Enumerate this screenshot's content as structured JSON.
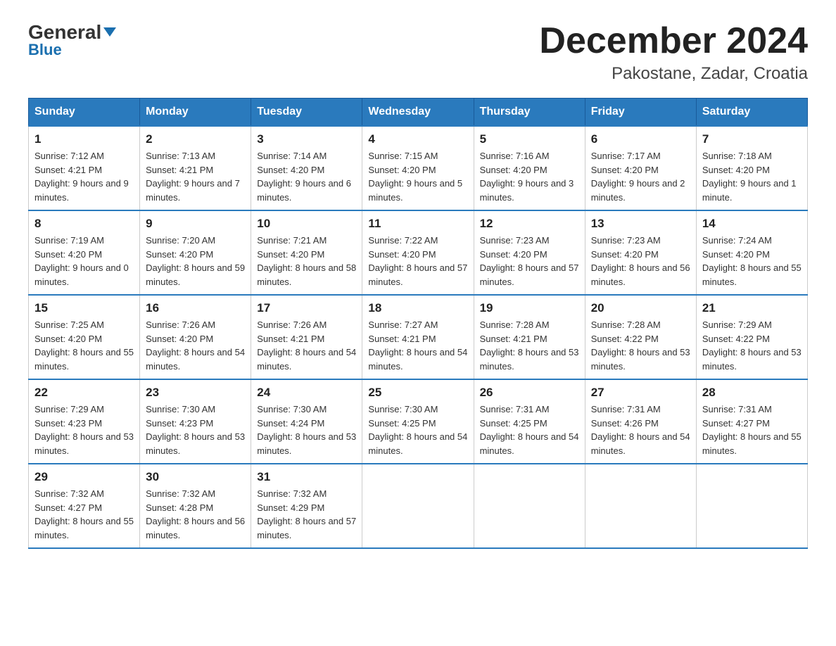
{
  "header": {
    "logo_general": "General",
    "logo_blue": "Blue",
    "month_title": "December 2024",
    "location": "Pakostane, Zadar, Croatia"
  },
  "weekdays": [
    "Sunday",
    "Monday",
    "Tuesday",
    "Wednesday",
    "Thursday",
    "Friday",
    "Saturday"
  ],
  "weeks": [
    [
      {
        "day": "1",
        "sunrise": "7:12 AM",
        "sunset": "4:21 PM",
        "daylight": "9 hours and 9 minutes."
      },
      {
        "day": "2",
        "sunrise": "7:13 AM",
        "sunset": "4:21 PM",
        "daylight": "9 hours and 7 minutes."
      },
      {
        "day": "3",
        "sunrise": "7:14 AM",
        "sunset": "4:20 PM",
        "daylight": "9 hours and 6 minutes."
      },
      {
        "day": "4",
        "sunrise": "7:15 AM",
        "sunset": "4:20 PM",
        "daylight": "9 hours and 5 minutes."
      },
      {
        "day": "5",
        "sunrise": "7:16 AM",
        "sunset": "4:20 PM",
        "daylight": "9 hours and 3 minutes."
      },
      {
        "day": "6",
        "sunrise": "7:17 AM",
        "sunset": "4:20 PM",
        "daylight": "9 hours and 2 minutes."
      },
      {
        "day": "7",
        "sunrise": "7:18 AM",
        "sunset": "4:20 PM",
        "daylight": "9 hours and 1 minute."
      }
    ],
    [
      {
        "day": "8",
        "sunrise": "7:19 AM",
        "sunset": "4:20 PM",
        "daylight": "9 hours and 0 minutes."
      },
      {
        "day": "9",
        "sunrise": "7:20 AM",
        "sunset": "4:20 PM",
        "daylight": "8 hours and 59 minutes."
      },
      {
        "day": "10",
        "sunrise": "7:21 AM",
        "sunset": "4:20 PM",
        "daylight": "8 hours and 58 minutes."
      },
      {
        "day": "11",
        "sunrise": "7:22 AM",
        "sunset": "4:20 PM",
        "daylight": "8 hours and 57 minutes."
      },
      {
        "day": "12",
        "sunrise": "7:23 AM",
        "sunset": "4:20 PM",
        "daylight": "8 hours and 57 minutes."
      },
      {
        "day": "13",
        "sunrise": "7:23 AM",
        "sunset": "4:20 PM",
        "daylight": "8 hours and 56 minutes."
      },
      {
        "day": "14",
        "sunrise": "7:24 AM",
        "sunset": "4:20 PM",
        "daylight": "8 hours and 55 minutes."
      }
    ],
    [
      {
        "day": "15",
        "sunrise": "7:25 AM",
        "sunset": "4:20 PM",
        "daylight": "8 hours and 55 minutes."
      },
      {
        "day": "16",
        "sunrise": "7:26 AM",
        "sunset": "4:20 PM",
        "daylight": "8 hours and 54 minutes."
      },
      {
        "day": "17",
        "sunrise": "7:26 AM",
        "sunset": "4:21 PM",
        "daylight": "8 hours and 54 minutes."
      },
      {
        "day": "18",
        "sunrise": "7:27 AM",
        "sunset": "4:21 PM",
        "daylight": "8 hours and 54 minutes."
      },
      {
        "day": "19",
        "sunrise": "7:28 AM",
        "sunset": "4:21 PM",
        "daylight": "8 hours and 53 minutes."
      },
      {
        "day": "20",
        "sunrise": "7:28 AM",
        "sunset": "4:22 PM",
        "daylight": "8 hours and 53 minutes."
      },
      {
        "day": "21",
        "sunrise": "7:29 AM",
        "sunset": "4:22 PM",
        "daylight": "8 hours and 53 minutes."
      }
    ],
    [
      {
        "day": "22",
        "sunrise": "7:29 AM",
        "sunset": "4:23 PM",
        "daylight": "8 hours and 53 minutes."
      },
      {
        "day": "23",
        "sunrise": "7:30 AM",
        "sunset": "4:23 PM",
        "daylight": "8 hours and 53 minutes."
      },
      {
        "day": "24",
        "sunrise": "7:30 AM",
        "sunset": "4:24 PM",
        "daylight": "8 hours and 53 minutes."
      },
      {
        "day": "25",
        "sunrise": "7:30 AM",
        "sunset": "4:25 PM",
        "daylight": "8 hours and 54 minutes."
      },
      {
        "day": "26",
        "sunrise": "7:31 AM",
        "sunset": "4:25 PM",
        "daylight": "8 hours and 54 minutes."
      },
      {
        "day": "27",
        "sunrise": "7:31 AM",
        "sunset": "4:26 PM",
        "daylight": "8 hours and 54 minutes."
      },
      {
        "day": "28",
        "sunrise": "7:31 AM",
        "sunset": "4:27 PM",
        "daylight": "8 hours and 55 minutes."
      }
    ],
    [
      {
        "day": "29",
        "sunrise": "7:32 AM",
        "sunset": "4:27 PM",
        "daylight": "8 hours and 55 minutes."
      },
      {
        "day": "30",
        "sunrise": "7:32 AM",
        "sunset": "4:28 PM",
        "daylight": "8 hours and 56 minutes."
      },
      {
        "day": "31",
        "sunrise": "7:32 AM",
        "sunset": "4:29 PM",
        "daylight": "8 hours and 57 minutes."
      },
      null,
      null,
      null,
      null
    ]
  ],
  "labels": {
    "sunrise": "Sunrise:",
    "sunset": "Sunset:",
    "daylight": "Daylight:"
  }
}
